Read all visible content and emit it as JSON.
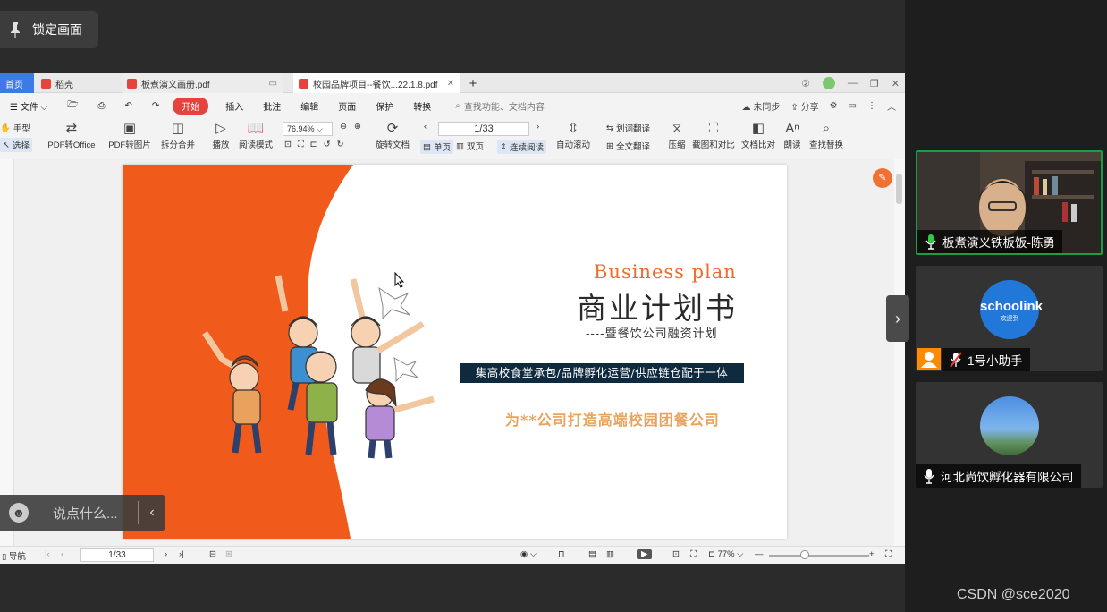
{
  "lock": {
    "label": "锁定画面",
    "icon": "pin-icon"
  },
  "tabs": {
    "home": "首页",
    "docer": "稻壳",
    "pdf1": "板煮演义画册.pdf",
    "pdf2": "校园品牌项目--餐饮...22.1.8.pdf",
    "add": "+"
  },
  "menu": {
    "file": "文件",
    "start": "开始",
    "insert": "插入",
    "annotate": "批注",
    "edit": "编辑",
    "page": "页面",
    "protect": "保护",
    "convert": "转换",
    "search_placeholder": "查找功能、文档内容",
    "sync": "未同步",
    "share": "分享"
  },
  "toolbar": {
    "hand": "手型",
    "select": "选择",
    "pdf_to_office": "PDF转Office",
    "pdf_to_image": "PDF转图片",
    "split_merge": "拆分合并",
    "play": "播放",
    "read_mode": "阅读模式",
    "zoom": "76.94%",
    "page_input": "1/33",
    "rotate_doc": "旋转文档",
    "single_page": "单页",
    "double_page": "双页",
    "continuous": "连续阅读",
    "auto_scroll": "自动滚动",
    "word_translate": "划词翻译",
    "full_translate": "全文翻译",
    "compress": "压缩",
    "screenshot_compare": "截图和对比",
    "doc_compare": "文档比对",
    "read_aloud": "朗读",
    "find_replace": "查找替换"
  },
  "slide": {
    "biz_plan": "Business plan",
    "title": "商业计划书",
    "subtitle": "----暨餐饮公司融资计划",
    "band": "集高校食堂承包/品牌孵化运营/供应链仓配于一体",
    "slogan": "为**公司打造高端校园团餐公司",
    "colors": {
      "accent": "#f05a1a",
      "band": "#0f2a3e",
      "slogan": "#e8a45e"
    }
  },
  "statusbar": {
    "nav": "导航",
    "page": "1/33",
    "zoom": "77%"
  },
  "chat": {
    "placeholder": "说点什么..."
  },
  "participants": [
    {
      "name": "板煮演义铁板饭-陈勇",
      "mic": "mic-on"
    },
    {
      "name": "1号小助手",
      "mic": "mic-muted",
      "logo_top": "schoolink",
      "logo_bottom": "欢迎到"
    },
    {
      "name": "河北尚饮孵化器有限公司",
      "mic": "mic-on"
    }
  ],
  "watermark": "CSDN @sce2020"
}
